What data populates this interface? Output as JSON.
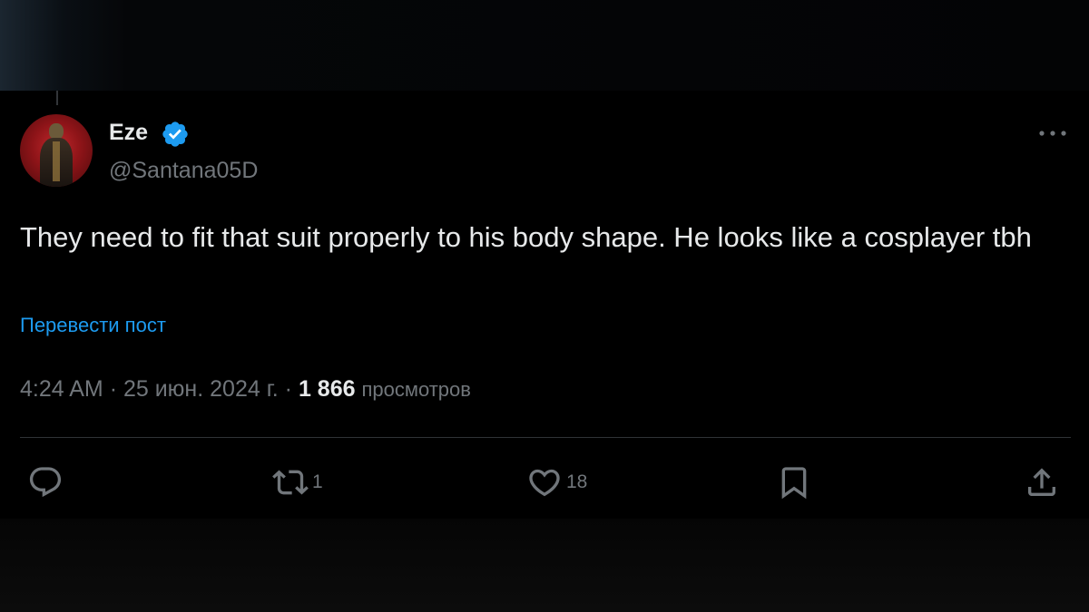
{
  "user": {
    "display_name": "Eze",
    "handle": "@Santana05D"
  },
  "tweet": {
    "text": "They need to fit that suit properly to his body shape. He looks like a cosplayer tbh",
    "translate_label": "Перевести пост",
    "time": "4:24 AM",
    "separator": "·",
    "date": "25 июн. 2024 г.",
    "views_count": "1 866",
    "views_label": "просмотров"
  },
  "actions": {
    "reply_count": "",
    "retweet_count": "1",
    "like_count": "18"
  },
  "icons": {
    "verified": "verified-badge-icon",
    "more": "more-dots-icon",
    "reply": "reply-icon",
    "retweet": "retweet-icon",
    "like": "heart-icon",
    "bookmark": "bookmark-icon",
    "share": "share-icon"
  },
  "colors": {
    "background": "#000000",
    "text": "#e7e9ea",
    "secondary": "#71767b",
    "accent": "#1d9bf0",
    "divider": "#2f3336"
  }
}
